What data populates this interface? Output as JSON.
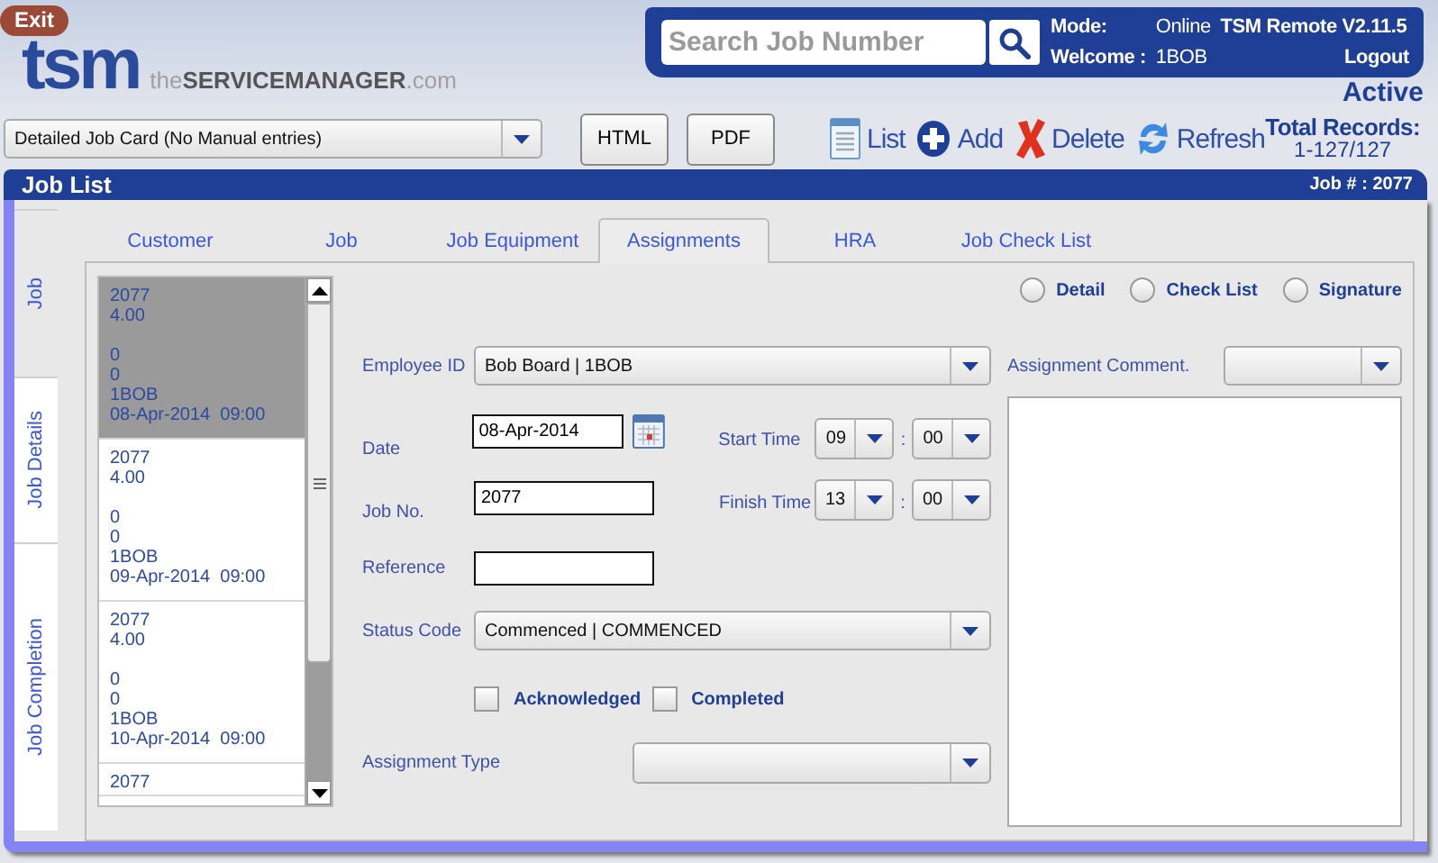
{
  "header": {
    "exit_button": "Exit",
    "logo": {
      "mark": "tsm",
      "tagline": "the**SERVICEMANAGER**.com"
    },
    "search": {
      "placeholder": "Search Job Number"
    },
    "mode_label": "Mode:",
    "mode_value": "Online",
    "app_version": "TSM Remote V2.11.5",
    "welcome_label": "Welcome :",
    "user": "1BOB",
    "logout": "Logout",
    "status": "Active"
  },
  "toolbar": {
    "report_dropdown": "Detailed Job Card (No Manual entries)",
    "export_buttons": [
      "HTML",
      "PDF"
    ],
    "actions": [
      {
        "kind": "list",
        "label": "List"
      },
      {
        "kind": "add",
        "label": "Add"
      },
      {
        "kind": "delete",
        "label": "Delete"
      },
      {
        "kind": "refresh",
        "label": "Refresh"
      }
    ],
    "total_records_label": "Total Records:",
    "total_records_value": "1-127/127"
  },
  "panel": {
    "title": "Job List",
    "job_label": "Job # :",
    "job_number": "2077"
  },
  "side_tabs": [
    {
      "label": "Job",
      "selected": true
    },
    {
      "label": "Job Details",
      "selected": false
    },
    {
      "label": "Job Completion",
      "selected": false
    }
  ],
  "tabs": [
    {
      "label": "Customer",
      "selected": false
    },
    {
      "label": "Job",
      "selected": false
    },
    {
      "label": "Job Equipment",
      "selected": false
    },
    {
      "label": "Assignments",
      "selected": true
    },
    {
      "label": "HRA",
      "selected": false
    },
    {
      "label": "Job Check List",
      "selected": false
    }
  ],
  "job_list": [
    {
      "job_no": "2077",
      "hours": "4.00",
      "value_1": "0",
      "value_2": "0",
      "employee": "1BOB",
      "datetime": "08-Apr-2014  09:00",
      "selected": true
    },
    {
      "job_no": "2077",
      "hours": "4.00",
      "value_1": "0",
      "value_2": "0",
      "employee": "1BOB",
      "datetime": "09-Apr-2014  09:00",
      "selected": false
    },
    {
      "job_no": "2077",
      "hours": "4.00",
      "value_1": "0",
      "value_2": "0",
      "employee": "1BOB",
      "datetime": "10-Apr-2014  09:00",
      "selected": false
    },
    {
      "job_no": "2077",
      "selected": false
    }
  ],
  "view_options": [
    {
      "label": "Detail",
      "selected": false
    },
    {
      "label": "Check List",
      "selected": false
    },
    {
      "label": "Signature",
      "selected": false
    }
  ],
  "form": {
    "employee_id": {
      "label": "Employee ID",
      "value": "Bob Board | 1BOB"
    },
    "date": {
      "label": "Date",
      "value": "08-Apr-2014"
    },
    "start_time": {
      "label": "Start Time",
      "hour": "09",
      "separator": ":",
      "minute": "00"
    },
    "job_no": {
      "label": "Job No.",
      "value": "2077"
    },
    "finish_time": {
      "label": "Finish Time",
      "hour": "13",
      "separator": ":",
      "minute": "00"
    },
    "reference": {
      "label": "Reference"
    },
    "status_code": {
      "label": "Status Code",
      "value": "Commenced | COMMENCED"
    },
    "checks": [
      {
        "label": "Acknowledged",
        "checked": false
      },
      {
        "label": "Completed",
        "checked": false
      }
    ],
    "assignment_type": {
      "label": "Assignment Type"
    },
    "assignment_comment": {
      "label": "Assignment Comment."
    }
  }
}
